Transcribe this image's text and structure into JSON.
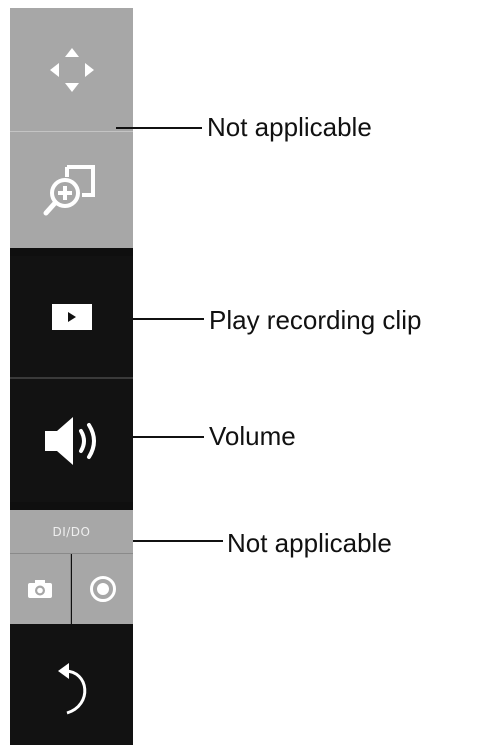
{
  "toolbar": {
    "buttons": [
      {
        "id": "move",
        "icon": "move-arrows-icon"
      },
      {
        "id": "zoom",
        "icon": "zoom-in-icon"
      },
      {
        "id": "play",
        "icon": "play-icon"
      },
      {
        "id": "volume",
        "icon": "speaker-icon"
      },
      {
        "id": "dido",
        "label": "DI/DO"
      },
      {
        "id": "snapshot",
        "icon": "camera-icon"
      },
      {
        "id": "record",
        "icon": "record-icon"
      },
      {
        "id": "back",
        "icon": "undo-arrow-icon"
      }
    ],
    "dido_label": "DI/DO"
  },
  "annotations": {
    "zoom_note": "Not applicable",
    "play_note": "Play recording clip",
    "volume_note": "Volume",
    "dido_note": "Not applicable"
  },
  "colors": {
    "panel_dark": "#121212",
    "panel_grey": "#a7a7a7",
    "icon_white": "#ffffff",
    "text": "#111111"
  }
}
